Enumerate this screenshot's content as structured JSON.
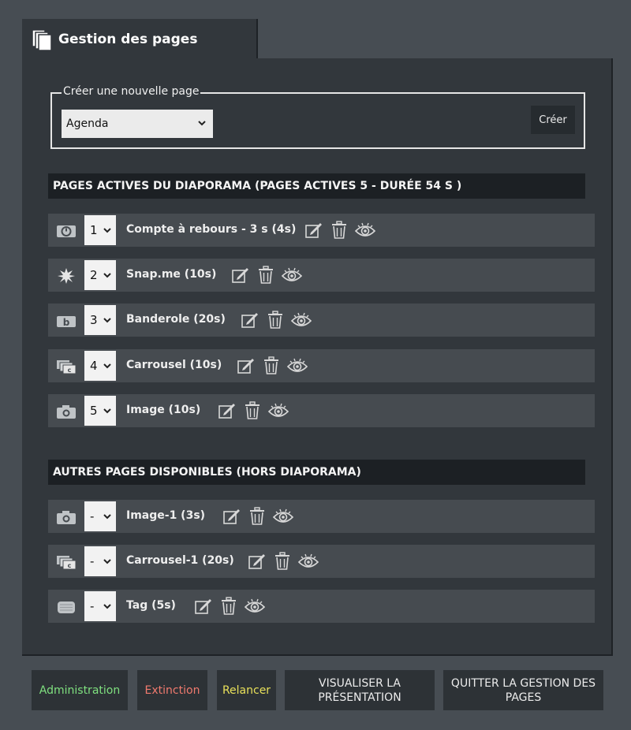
{
  "header": {
    "title": "Gestion des pages",
    "icon": "pages-icon"
  },
  "create": {
    "legend": "Créer une nouvelle page",
    "selected_type": "Agenda",
    "create_label": "Créer"
  },
  "active": {
    "heading": "PAGES ACTIVES DU DIAPORAMA (PAGES ACTIVES 5 - DURÉE 54 S )",
    "rows": [
      {
        "icon": "countdown-icon",
        "order": "1",
        "label": "Compte à rebours - 3 s (4s)"
      },
      {
        "icon": "snapme-icon",
        "order": "2",
        "label": "Snap.me (10s)"
      },
      {
        "icon": "banner-icon",
        "order": "3",
        "label": "Banderole (20s)"
      },
      {
        "icon": "carousel-icon",
        "order": "4",
        "label": "Carrousel (10s)"
      },
      {
        "icon": "camera-icon",
        "order": "5",
        "label": "Image (10s)"
      }
    ]
  },
  "other": {
    "heading": "AUTRES PAGES DISPONIBLES (HORS DIAPORAMA)",
    "rows": [
      {
        "icon": "camera-icon",
        "order": "-",
        "label": "Image-1 (3s)"
      },
      {
        "icon": "carousel-icon",
        "order": "-",
        "label": "Carrousel-1 (20s)"
      },
      {
        "icon": "tag-icon",
        "order": "-",
        "label": "Tag (5s)"
      }
    ]
  },
  "footer": {
    "administration": "Administration",
    "extinction": "Extinction",
    "relancer": "Relancer",
    "visualiser": "VISUALISER LA PRÉSENTATION",
    "quitter": "QUITTER LA GESTION DES PAGES"
  },
  "colors": {
    "administration": "#7fe07f",
    "extinction": "#f07a6e",
    "relancer": "#e8e05a",
    "panel": "#32373c",
    "row": "#464b50",
    "header_bar": "#1c2024"
  }
}
